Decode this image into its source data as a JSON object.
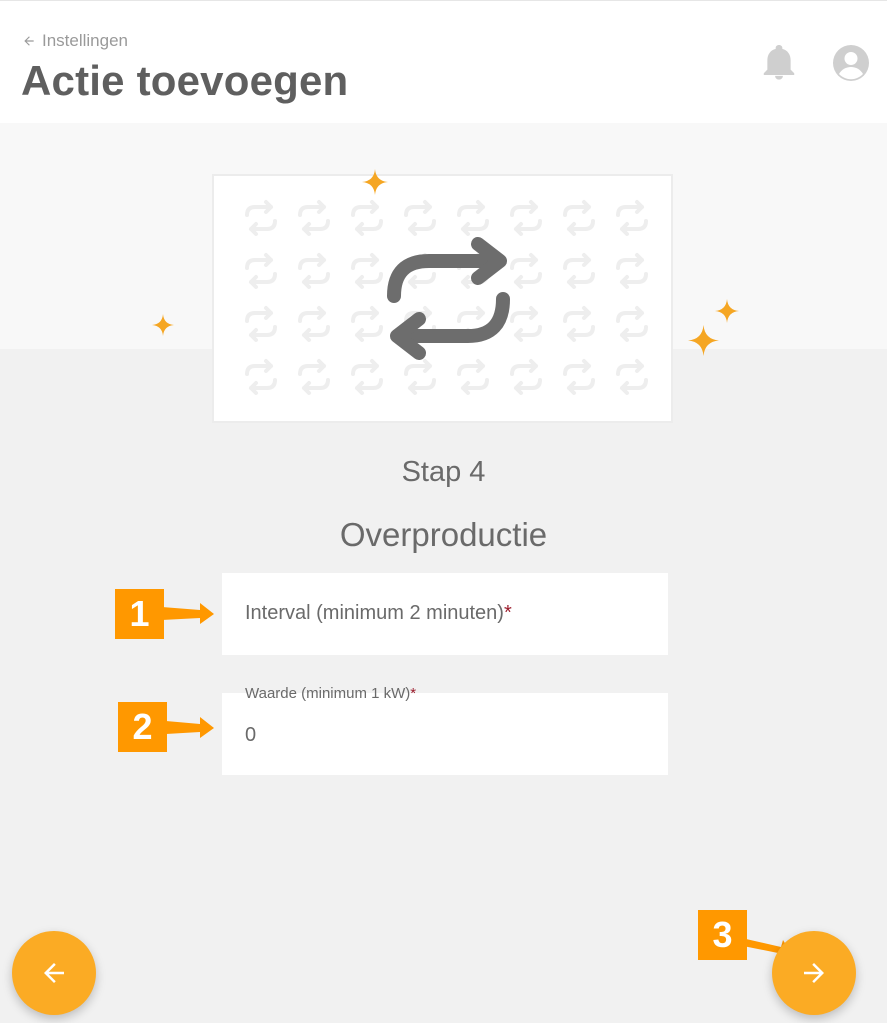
{
  "header": {
    "back_label": "Instellingen",
    "title": "Actie toevoegen",
    "icons": [
      "arrow-left-icon",
      "bell-icon",
      "user-avatar-icon"
    ]
  },
  "wizard": {
    "step_label": "Stap 4",
    "section_title": "Overproductie",
    "illustration_icon": "repeat-icon"
  },
  "form": {
    "interval": {
      "label": "Interval (minimum 2 minuten)",
      "required_mark": "*",
      "value": ""
    },
    "value_field": {
      "label": "Waarde (minimum 1 kW)",
      "required_mark": "*",
      "value": "0"
    }
  },
  "navigation": {
    "prev_icon": "arrow-left-icon",
    "next_icon": "arrow-right-icon"
  },
  "callouts": [
    "1",
    "2",
    "3"
  ],
  "colors": {
    "accent": "#fbab24",
    "callout": "#ff9800",
    "sparkle": "#f5a623",
    "required": "#9b1c2c",
    "text": "#6a6a6a"
  }
}
